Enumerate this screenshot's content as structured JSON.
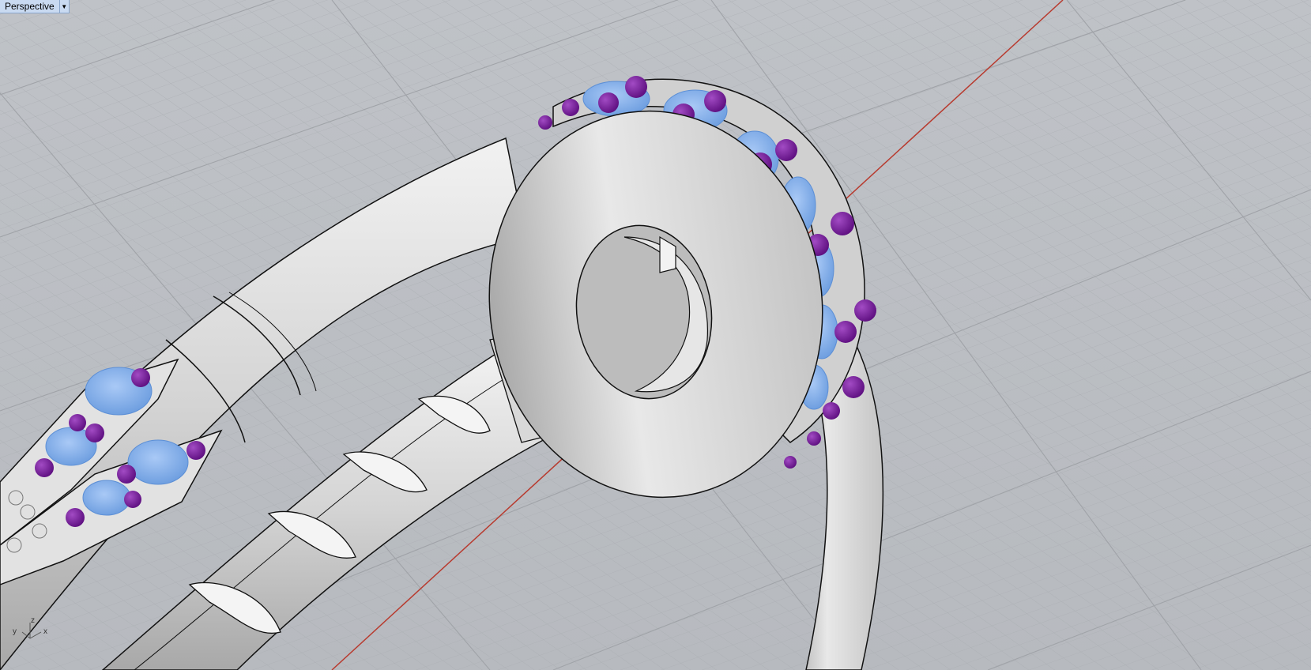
{
  "viewport": {
    "title": "Perspective",
    "dropdown_icon": "triangle-down"
  },
  "axis_widget": {
    "x_label": "x",
    "y_label": "y",
    "z_label": "z"
  },
  "colors": {
    "background": "#b9bcc1",
    "grid_minor": "#aeb1b6",
    "grid_major": "#a2a5aa",
    "x_axis": "#b83a2e",
    "metal": "#d6d6d6",
    "gem": "#8ab6f0",
    "prong": "#7a1a9a",
    "tab_bg": "#c9daf1"
  }
}
